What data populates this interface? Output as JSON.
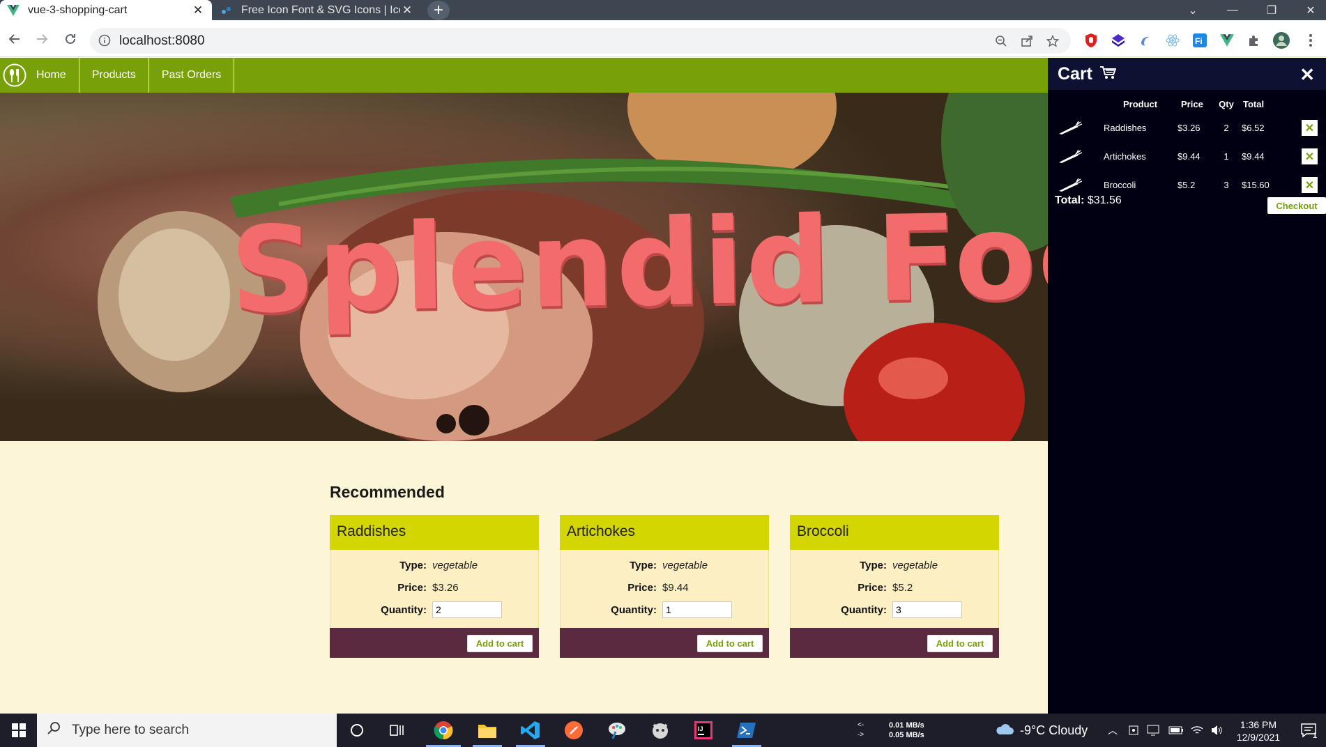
{
  "browser": {
    "tabs": [
      {
        "title": "vue-3-shopping-cart",
        "active": true,
        "favicon": "vue-logo-icon"
      },
      {
        "title": "Free Icon Font & SVG Icons | IcoF",
        "active": false,
        "favicon": "icofont-icon"
      }
    ],
    "url": "localhost:8080",
    "accent": "#3d4651"
  },
  "nav": {
    "items": [
      {
        "label": "Home"
      },
      {
        "label": "Products"
      },
      {
        "label": "Past Orders"
      }
    ],
    "color": "#78a009"
  },
  "hero": {
    "title": "Splendid Food"
  },
  "recommended": {
    "heading": "Recommended",
    "labels": {
      "type": "Type:",
      "price": "Price:",
      "quantity": "Quantity:",
      "add": "Add to cart"
    },
    "products": [
      {
        "name": "Raddishes",
        "type": "vegetable",
        "price": "$3.26",
        "quantity": "2"
      },
      {
        "name": "Artichokes",
        "type": "vegetable",
        "price": "$9.44",
        "quantity": "1"
      },
      {
        "name": "Broccoli",
        "type": "vegetable",
        "price": "$5.2",
        "quantity": "3"
      }
    ]
  },
  "cart": {
    "title": "Cart",
    "columns": {
      "product": "Product",
      "price": "Price",
      "qty": "Qty",
      "total": "Total"
    },
    "items": [
      {
        "product": "Raddishes",
        "price": "$3.26",
        "qty": "2",
        "total": "$6.52"
      },
      {
        "product": "Artichokes",
        "price": "$9.44",
        "qty": "1",
        "total": "$9.44"
      },
      {
        "product": "Broccoli",
        "price": "$5.2",
        "qty": "3",
        "total": "$15.60"
      }
    ],
    "total_label": "Total:",
    "total_value": "$31.56",
    "checkout_label": "Checkout"
  },
  "taskbar": {
    "search_placeholder": "Type here to search",
    "net_up": "0.01 MB/s",
    "net_down": "0.05 MB/s",
    "net_up_arrow": "<-",
    "net_down_arrow": "->",
    "weather": "-9°C  Cloudy",
    "time": "1:36 PM",
    "date": "12/9/2021",
    "notifications": "1"
  }
}
